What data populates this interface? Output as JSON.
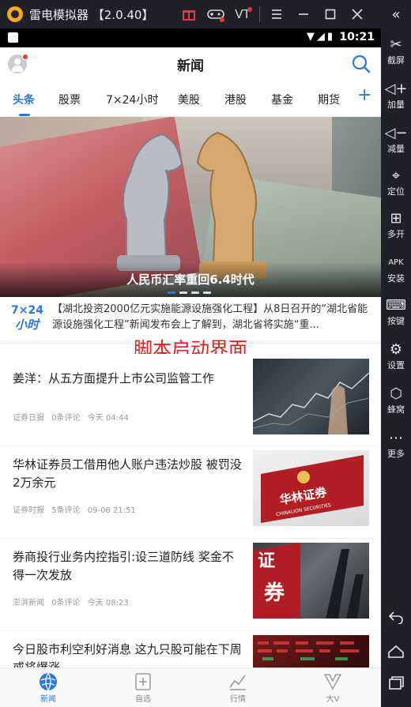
{
  "emulator": {
    "title": "雷电模拟器 【2.0.40】",
    "vt_label": "VT",
    "side_panel": [
      {
        "label": "截屏",
        "icon": "scissors-icon"
      },
      {
        "label": "加量",
        "icon": "volume-up-icon"
      },
      {
        "label": "减量",
        "icon": "volume-down-icon"
      },
      {
        "label": "定位",
        "icon": "location-icon"
      },
      {
        "label": "多开",
        "icon": "multi-open-icon"
      },
      {
        "label": "安装",
        "icon": "apk-install-icon"
      },
      {
        "label": "按键",
        "icon": "keyboard-icon"
      },
      {
        "label": "设置",
        "icon": "gear-icon"
      },
      {
        "label": "蜂窝",
        "icon": "hive-icon"
      },
      {
        "label": "更多",
        "icon": "more-dots-icon"
      }
    ]
  },
  "statusbar": {
    "time": "10:21"
  },
  "app": {
    "title": "新闻",
    "tabs": [
      "头条",
      "股票",
      "7×24小时",
      "美股",
      "港股",
      "基金",
      "期货"
    ],
    "active_tab": "头条",
    "banner": {
      "caption": "人民币汇率重回6.4时代"
    },
    "flash": {
      "logo_top": "7×24",
      "logo_bottom": "小时",
      "text": "【湖北投资2000亿元实施能源设施强化工程】从8日召开的“湖北省能源设施强化工程”新闻发布会上了解到，湖北省将实施“重..."
    },
    "overlay_label": "脚本启动界面",
    "news": [
      {
        "title": "姜洋：从五方面提升上市公司监管工作",
        "source": "证券日报",
        "comments": "0条评论",
        "time": "今天 04:44"
      },
      {
        "title": "华林证券员工借用他人账户违法炒股 被罚没2万余元",
        "source": "证券时报",
        "comments": "5条评论",
        "time": "09-08 21:51"
      },
      {
        "title": "券商投行业务内控指引:设三道防线 奖金不得一次发放",
        "source": "澎湃新闻",
        "comments": "0条评论",
        "time": "今天 08:23"
      },
      {
        "title": "今日股市利空利好消息 这九只股可能在下周或将爆涨",
        "source": "",
        "comments": "",
        "time": ""
      }
    ],
    "thumb_texts": {
      "hualin_cn": "华林证券",
      "hualin_en": "CHINALION SECURITIES",
      "quan": "券",
      "zheng": "证"
    },
    "bottom_nav": [
      {
        "label": "新闻",
        "icon": "globe-icon",
        "active": true
      },
      {
        "label": "自选",
        "icon": "add-favorite-icon",
        "active": false
      },
      {
        "label": "行情",
        "icon": "chart-line-icon",
        "active": false
      },
      {
        "label": "大V",
        "icon": "big-v-icon",
        "active": false
      }
    ]
  },
  "colors": {
    "accent": "#2a78d8",
    "overlay_red": "#e02020",
    "chrome": "#1f2127"
  }
}
